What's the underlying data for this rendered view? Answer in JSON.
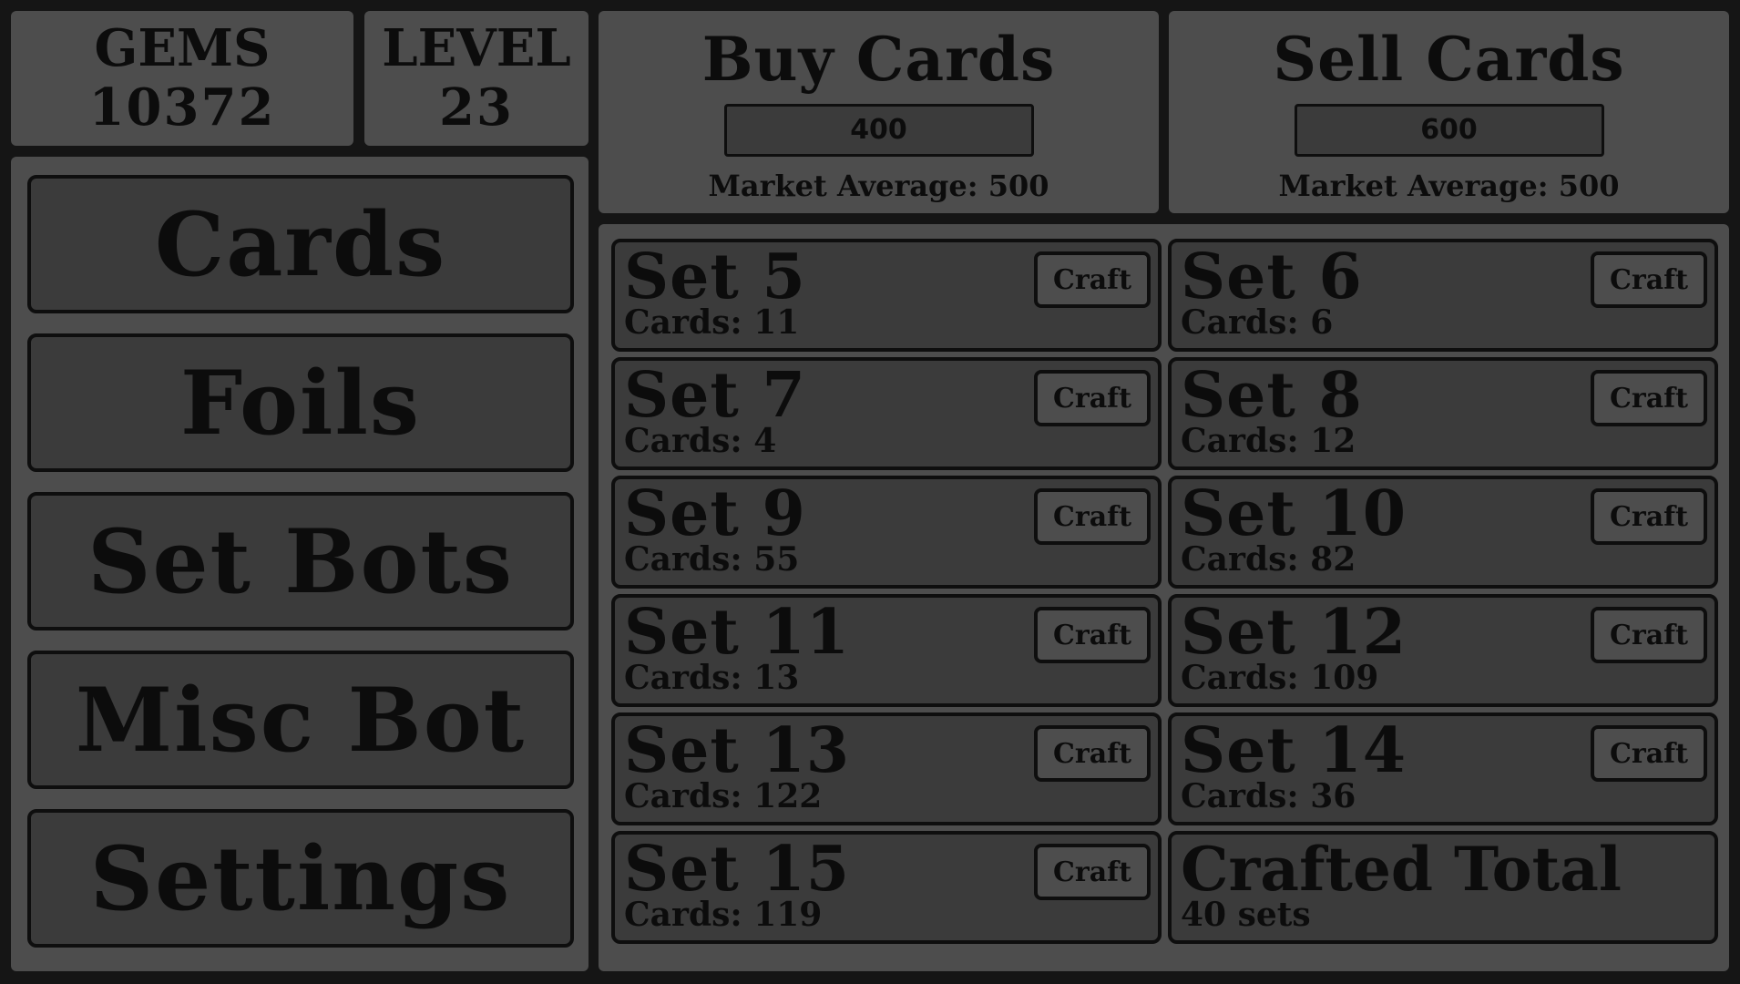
{
  "stats": {
    "gems_label": "GEMS",
    "gems_value": "10372",
    "level_label": "LEVEL",
    "level_value": "23"
  },
  "buy": {
    "title": "Buy Cards",
    "price": "400",
    "average": "Market Average: 500"
  },
  "sell": {
    "title": "Sell Cards",
    "price": "600",
    "average": "Market Average: 500"
  },
  "nav": {
    "items": [
      {
        "label": "Cards"
      },
      {
        "label": "Foils"
      },
      {
        "label": "Set Bots"
      },
      {
        "label": "Misc Bot"
      },
      {
        "label": "Settings"
      }
    ]
  },
  "craft_label": "Craft",
  "sets": [
    {
      "name": "Set 5",
      "cards": "Cards: 11"
    },
    {
      "name": "Set 6",
      "cards": "Cards: 6"
    },
    {
      "name": "Set 7",
      "cards": "Cards: 4"
    },
    {
      "name": "Set 8",
      "cards": "Cards: 12"
    },
    {
      "name": "Set 9",
      "cards": "Cards: 55"
    },
    {
      "name": "Set 10",
      "cards": "Cards: 82"
    },
    {
      "name": "Set 11",
      "cards": "Cards: 13"
    },
    {
      "name": "Set 12",
      "cards": "Cards: 109"
    },
    {
      "name": "Set 13",
      "cards": "Cards: 122"
    },
    {
      "name": "Set 14",
      "cards": "Cards: 36"
    },
    {
      "name": "Set 15",
      "cards": "Cards: 119"
    }
  ],
  "crafted": {
    "title": "Crafted Total",
    "value": "40 sets"
  },
  "colors": {
    "background": "#151515",
    "panel": "#4d4d4d",
    "inset": "#3b3b3b",
    "border": "#0e0e0e"
  }
}
